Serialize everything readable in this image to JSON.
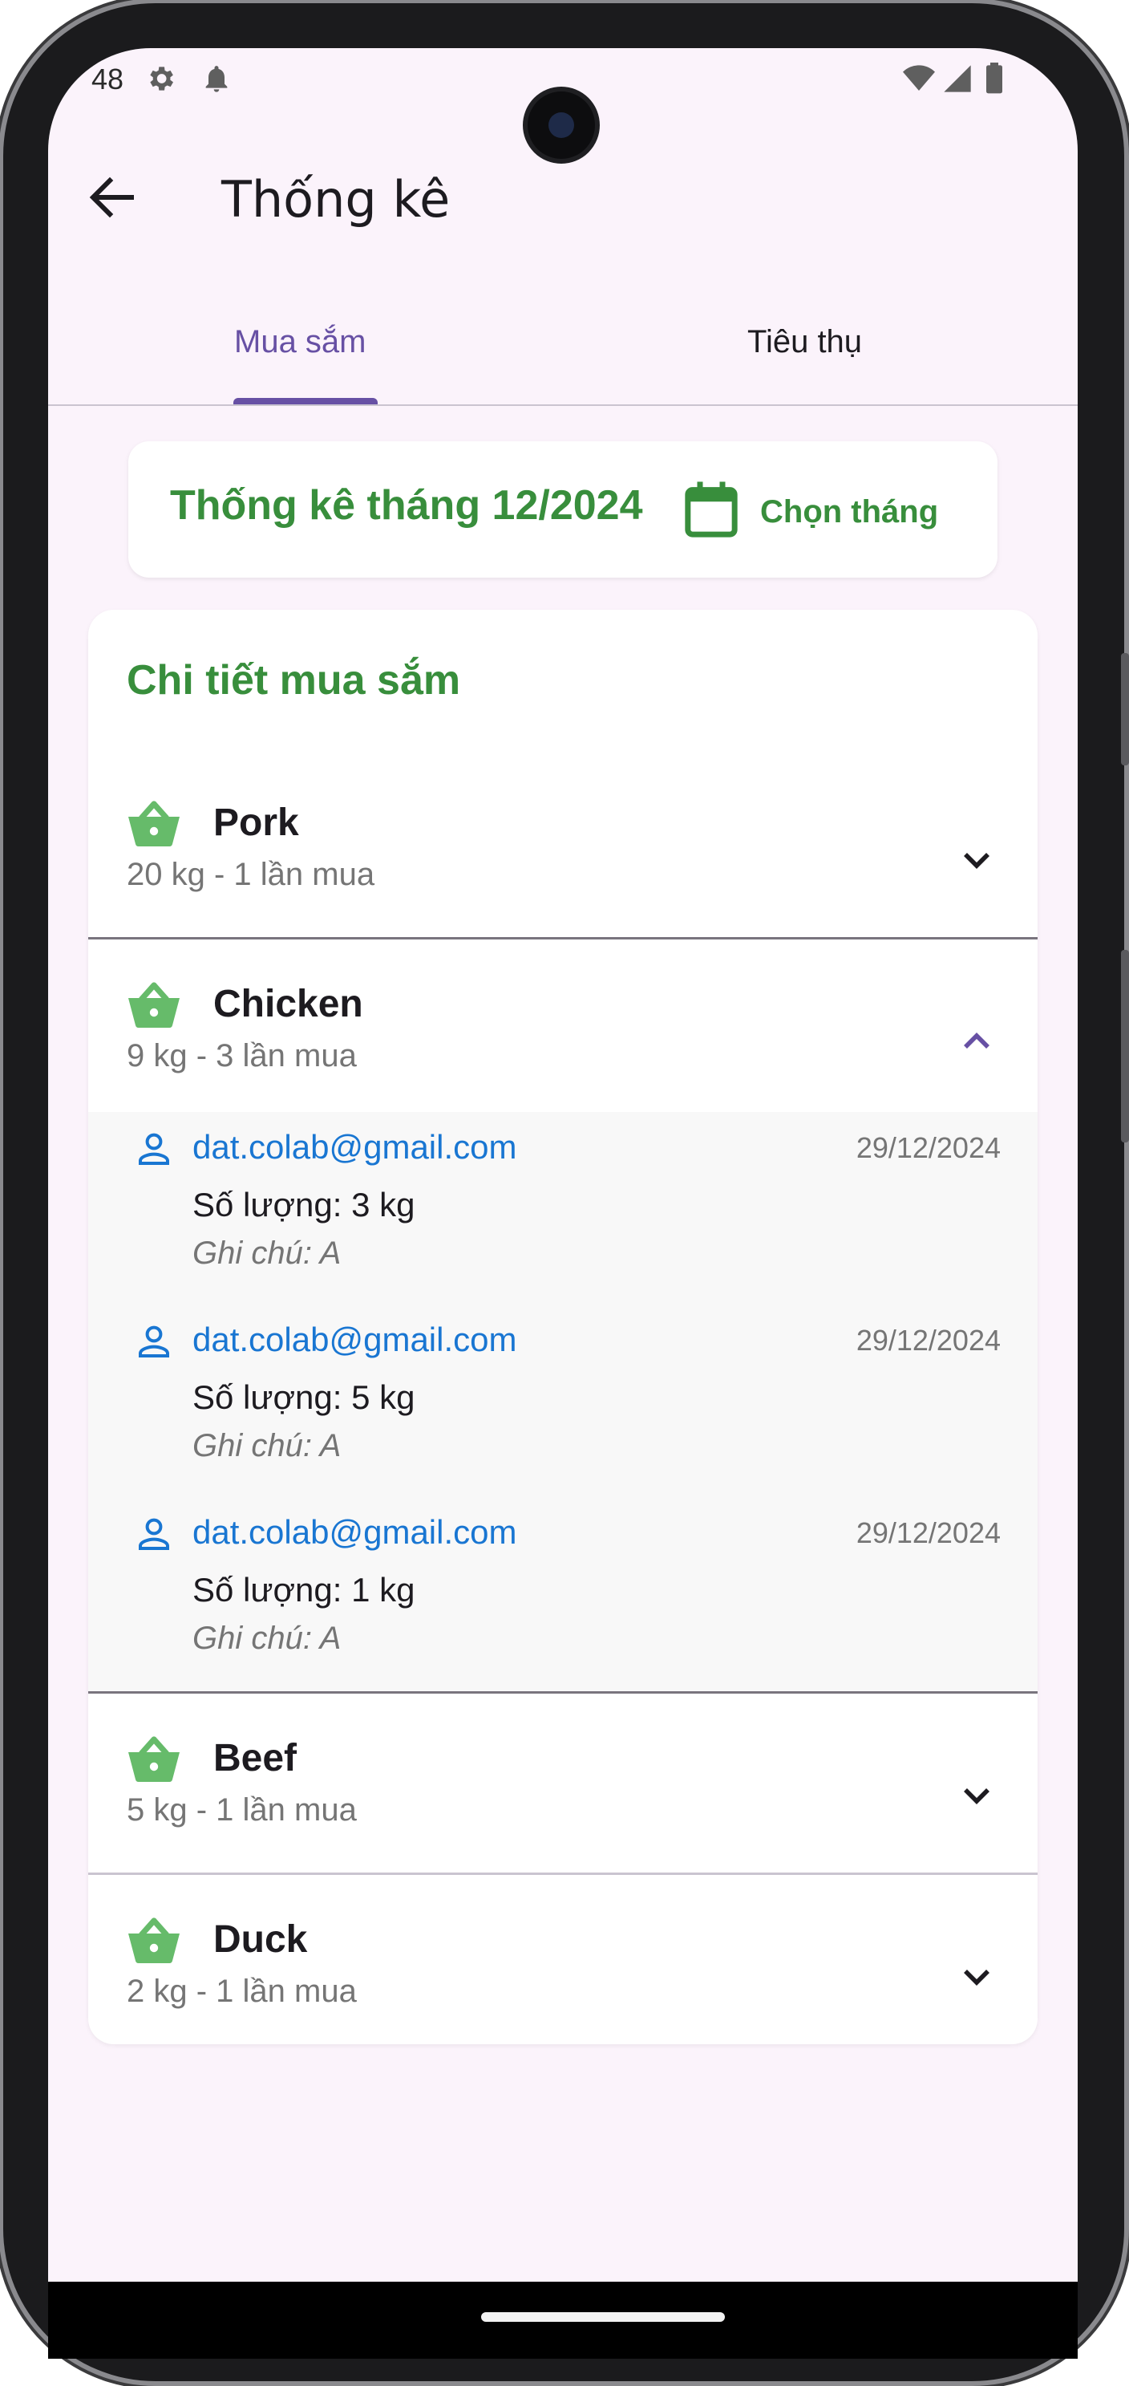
{
  "status_bar": {
    "time": "48",
    "icons": [
      "gear-icon",
      "bell-icon",
      "wifi-icon",
      "signal-icon",
      "battery-icon"
    ]
  },
  "app_bar": {
    "title": "Thống kê",
    "back_icon": "arrow-left-icon"
  },
  "tabs": [
    {
      "label": "Mua sắm",
      "active": true
    },
    {
      "label": "Tiêu thụ",
      "active": false
    }
  ],
  "month_card": {
    "title": "Thống kê tháng 12/2024",
    "pick_label": "Chọn tháng",
    "icon": "calendar-icon"
  },
  "details": {
    "title": "Chi tiết mua sắm",
    "items": [
      {
        "name": "Pork",
        "summary": "20 kg - 1 lần mua",
        "expanded": false
      },
      {
        "name": "Chicken",
        "summary": "9 kg - 3 lần mua",
        "expanded": true,
        "purchases": [
          {
            "email": "dat.colab@gmail.com",
            "date": "29/12/2024",
            "quantity": "Số lượng: 3 kg",
            "note": "Ghi chú: A"
          },
          {
            "email": "dat.colab@gmail.com",
            "date": "29/12/2024",
            "quantity": "Số lượng: 5 kg",
            "note": "Ghi chú: A"
          },
          {
            "email": "dat.colab@gmail.com",
            "date": "29/12/2024",
            "quantity": "Số lượng: 1 kg",
            "note": "Ghi chú: A"
          }
        ]
      },
      {
        "name": "Beef",
        "summary": "5 kg - 1 lần mua",
        "expanded": false
      },
      {
        "name": "Duck",
        "summary": "2 kg - 1 lần mua",
        "expanded": false
      }
    ]
  },
  "colors": {
    "primary_purple": "#6750a4",
    "green_accent": "#388e3c",
    "basket_green": "#66bb6a",
    "link_blue": "#1976d2",
    "background": "#fbf3fb"
  }
}
